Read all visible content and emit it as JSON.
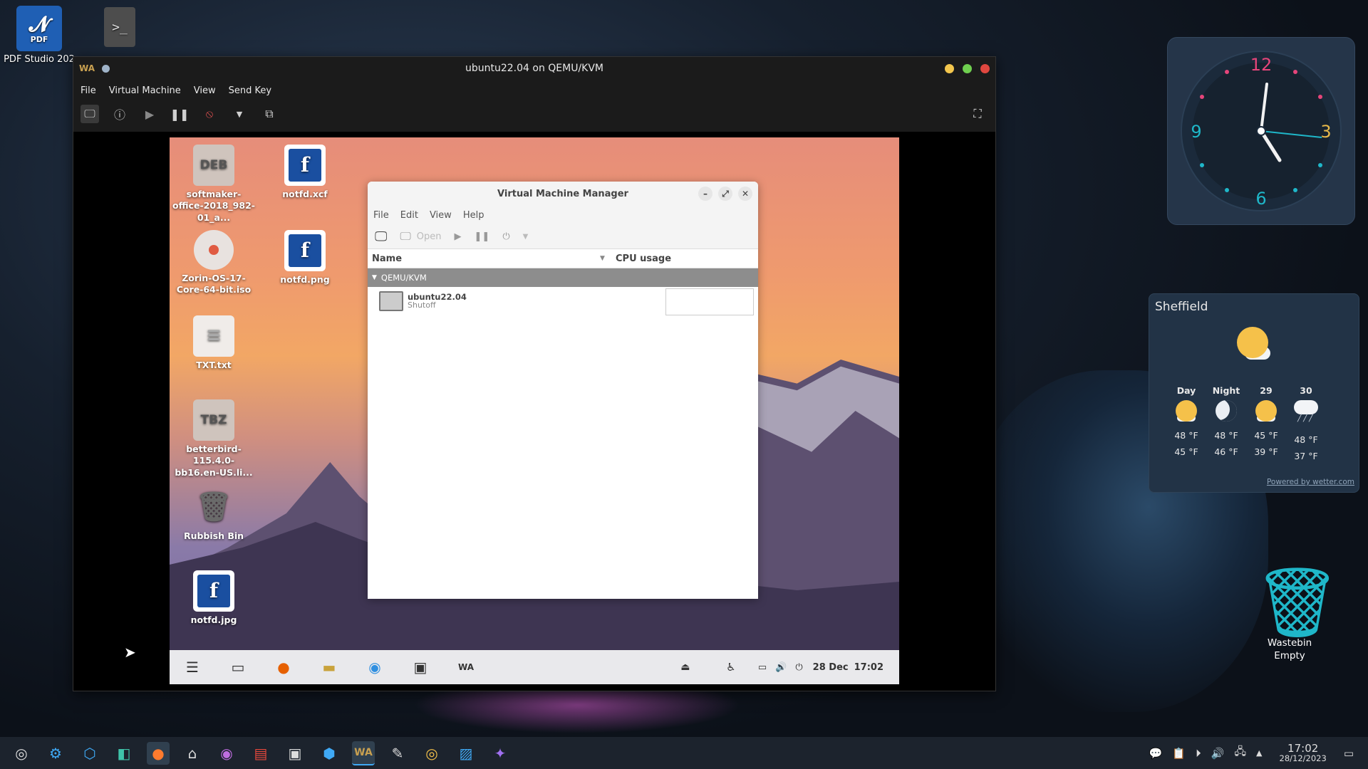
{
  "host_desktop": {
    "icons": [
      {
        "label": "PDF Studio 202",
        "logo_text": "PDF"
      },
      {
        "label": "",
        "symbol": ">_"
      }
    ],
    "wastebin": {
      "label": "Wastebin",
      "status": "Empty"
    }
  },
  "vm_window": {
    "title": "ubuntu22.04 on QEMU/KVM",
    "app_logo": "WA",
    "menu": [
      "File",
      "Virtual Machine",
      "View",
      "Send Key"
    ],
    "colors": {
      "min": "#f3c64d",
      "max": "#6fcf4f",
      "close": "#e0473f"
    }
  },
  "guest": {
    "icons": [
      {
        "label": "softmaker-office-2018_982-01_a...",
        "type_text": "DEB"
      },
      {
        "label": "notfd.xcf",
        "type_text": "f"
      },
      {
        "label": "Zorin-OS-17-Core-64-bit.iso"
      },
      {
        "label": "notfd.png",
        "type_text": "f"
      },
      {
        "label": "TXT.txt"
      },
      {
        "label": "betterbird-115.4.0-bb16.en-US.li...",
        "type_text": "TBZ"
      },
      {
        "label": "Rubbish Bin"
      },
      {
        "label": "notfd.jpg",
        "type_text": "f"
      }
    ],
    "taskbar": {
      "date": "28 Dec",
      "time": "17:02"
    }
  },
  "vmm": {
    "title": "Virtual Machine Manager",
    "menu": [
      "File",
      "Edit",
      "View",
      "Help"
    ],
    "toolbar": {
      "open_label": "Open"
    },
    "columns": {
      "name": "Name",
      "cpu": "CPU usage"
    },
    "group": "QEMU/KVM",
    "vm": {
      "name": "ubuntu22.04",
      "status": "Shutoff"
    }
  },
  "clock": {
    "numbers": [
      "12",
      "3",
      "6",
      "9"
    ]
  },
  "weather": {
    "city": "Sheffield",
    "columns": [
      {
        "label": "Day",
        "high": "48 °F",
        "low": "45 °F",
        "icon": "sun-cloud"
      },
      {
        "label": "Night",
        "high": "48 °F",
        "low": "46 °F",
        "icon": "moon"
      },
      {
        "label": "29",
        "high": "45 °F",
        "low": "39 °F",
        "icon": "sun-cloud"
      },
      {
        "label": "30",
        "high": "48 °F",
        "low": "37 °F",
        "icon": "rain"
      }
    ],
    "credit": "Powered by wetter.com"
  },
  "host_taskbar": {
    "time": "17:02",
    "date": "28/12/2023"
  }
}
